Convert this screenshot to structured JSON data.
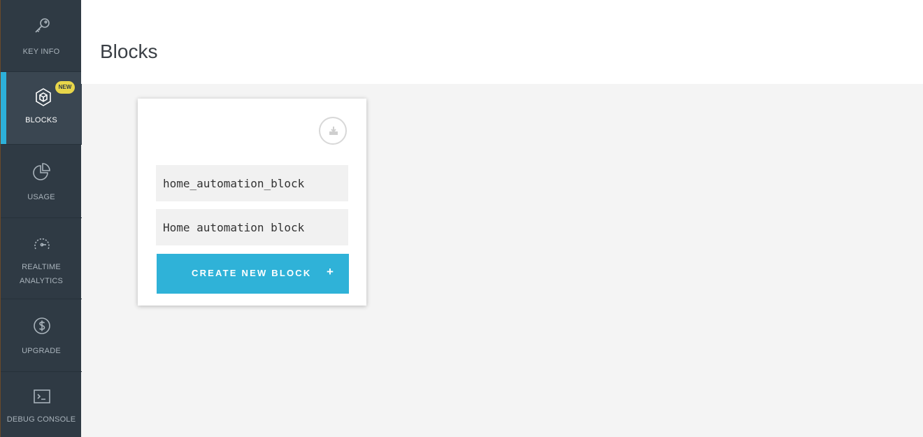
{
  "sidebar": {
    "items": [
      {
        "label": "KEY INFO",
        "icon": "key-icon"
      },
      {
        "label": "BLOCKS",
        "icon": "blocks-icon",
        "badge": "NEW",
        "active": true
      },
      {
        "label": "USAGE",
        "icon": "pie-chart-icon"
      },
      {
        "label": "REALTIME",
        "label2": "ANALYTICS",
        "icon": "gauge-icon"
      },
      {
        "label": "UPGRADE",
        "icon": "dollar-icon"
      },
      {
        "label": "DEBUG CONSOLE",
        "icon": "terminal-icon"
      }
    ]
  },
  "header": {
    "title": "Blocks"
  },
  "card": {
    "download_icon": "download-icon",
    "name_value": "home_automation_block",
    "description_value": "Home automation block",
    "create_label": "CREATE NEW BLOCK",
    "create_icon": "+"
  },
  "colors": {
    "sidebar_bg": "#2f3a44",
    "accent": "#2db0d9",
    "button": "#2fb2d8",
    "badge": "#e8d64a"
  }
}
